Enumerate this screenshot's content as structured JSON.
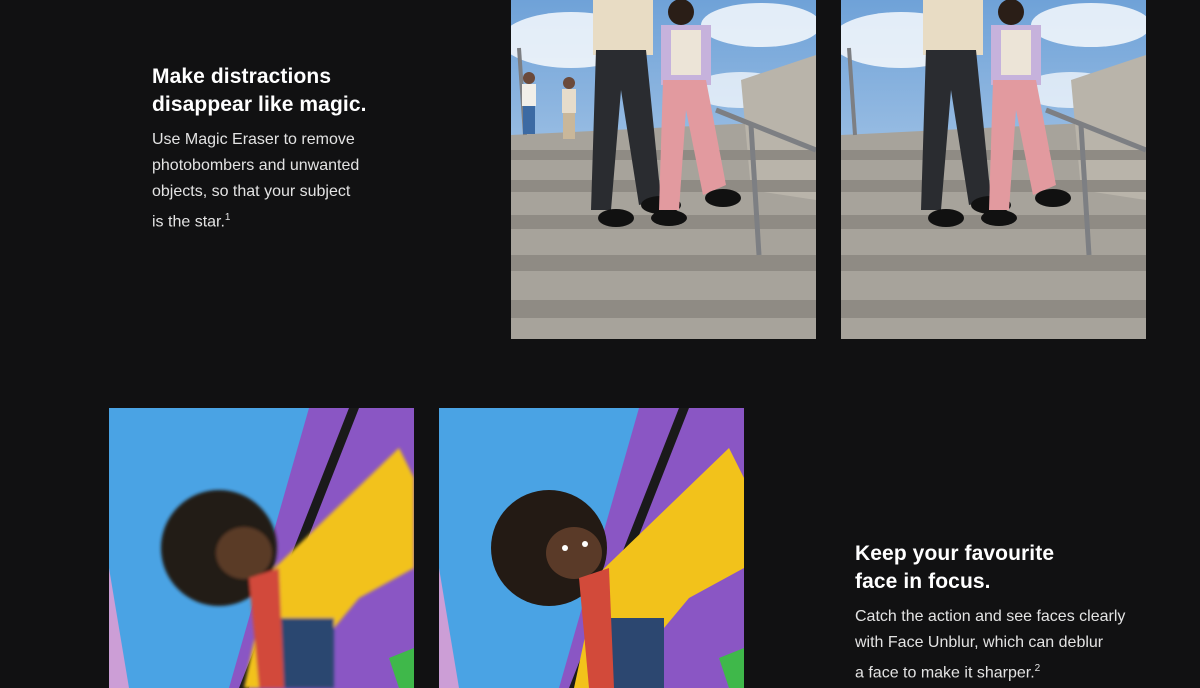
{
  "magic_eraser": {
    "title_line1": "Make distractions",
    "title_line2": "disappear like magic.",
    "body_lines": [
      "Use Magic Eraser to remove",
      "photobombers and unwanted",
      "objects, so that your subject",
      "is the star."
    ],
    "footnote": "1",
    "images": [
      "before-photo-with-photobombers",
      "after-photo-photobombers-removed"
    ]
  },
  "face_unblur": {
    "title_line1": "Keep your favourite",
    "title_line2": "face in focus.",
    "body_lines": [
      "Catch the action and see faces clearly",
      "with Face Unblur, which can deblur",
      "a face to make it sharper."
    ],
    "footnote": "2",
    "images": [
      "blurred-face-photo",
      "deblurred-face-photo"
    ]
  },
  "colors": {
    "page_background": "#111112",
    "title_text": "#ffffff",
    "body_text": "#e3e3e3"
  }
}
